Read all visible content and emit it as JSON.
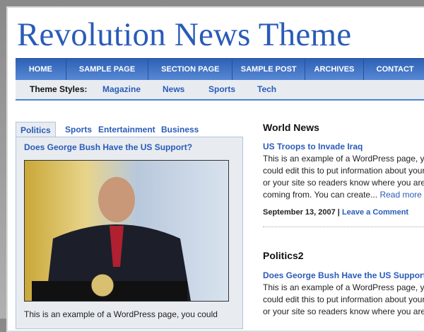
{
  "site_title": "Revolution News Theme",
  "nav": [
    "HOME",
    "SAMPLE PAGE",
    "SECTION PAGE",
    "SAMPLE POST",
    "ARCHIVES",
    "CONTACT"
  ],
  "theme_styles": {
    "label": "Theme Styles:",
    "items": [
      "Magazine",
      "News",
      "Sports",
      "Tech"
    ]
  },
  "tabs": [
    "Politics",
    "Sports",
    "Entertainment",
    "Business"
  ],
  "featured": {
    "headline": "Does George Bush Have the US Support?",
    "excerpt": "This is an example of a WordPress page, you could"
  },
  "sections": [
    {
      "title": "World News",
      "headline": "US Troops to Invade Iraq",
      "lines": [
        "This is an example of a WordPress page, you",
        "could edit this to put information about yourself",
        "or your site so readers know where you are",
        "coming from. You can create..."
      ],
      "read_more": "Read more",
      "date": "September 13, 2007 |",
      "comment": "Leave a Comment"
    },
    {
      "title": "Politics2",
      "headline": "Does George Bush Have the US Support?",
      "lines": [
        "This is an example of a WordPress page, you",
        "could edit this to put information about yourself",
        "or your site so readers know where you are"
      ]
    }
  ]
}
